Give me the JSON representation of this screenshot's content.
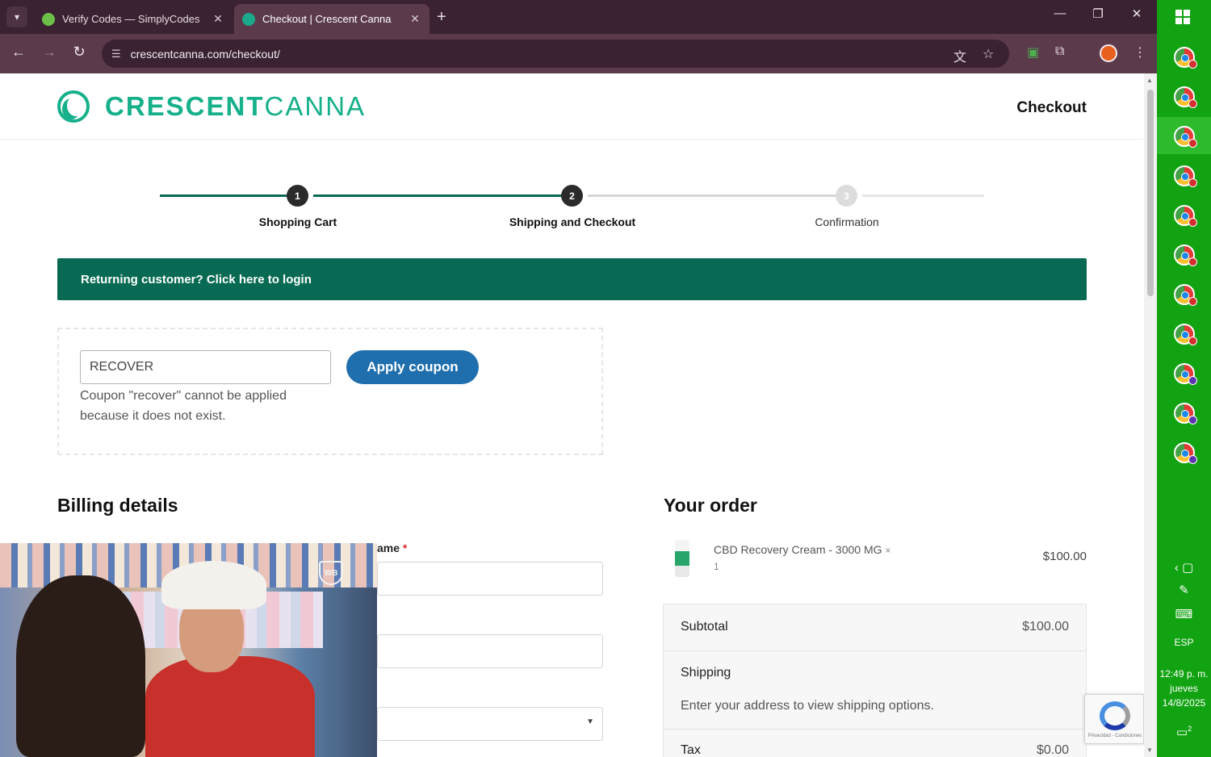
{
  "browser": {
    "tabs": [
      {
        "title": "Verify Codes — SimplyCodes",
        "active": false,
        "favicon_color": "#6cc04a"
      },
      {
        "title": "Checkout | Crescent Canna",
        "active": true,
        "favicon_color": "#1aa98a"
      }
    ],
    "new_tab_icon": "plus-icon",
    "url": "crescentcanna.com/checkout/",
    "colors": {
      "frame": "#3a2232",
      "toolbar": "#5b3a4c"
    }
  },
  "site": {
    "logo_bold": "CRESCENT",
    "logo_light": "CANNA",
    "header_title": "Checkout",
    "brand_color": "#16b08a"
  },
  "steps": [
    {
      "number": "1",
      "label": "Shopping Cart",
      "state": "complete"
    },
    {
      "number": "2",
      "label": "Shipping and Checkout",
      "state": "current"
    },
    {
      "number": "3",
      "label": "Confirmation",
      "state": "pending"
    }
  ],
  "login_banner": "Returning customer? Click here to login",
  "coupon": {
    "value": "RECOVER",
    "button": "Apply coupon",
    "error": "Coupon \"recover\" cannot be applied because it does not exist."
  },
  "billing": {
    "title": "Billing details",
    "partial_label": "ame",
    "required_mark": "*"
  },
  "order": {
    "title": "Your order",
    "item": {
      "name": "CBD Recovery Cream - 3000 MG",
      "qty": "× 1",
      "price": "$100.00"
    },
    "subtotal_label": "Subtotal",
    "subtotal_value": "$100.00",
    "shipping_label": "Shipping",
    "shipping_message": "Enter your address to view shipping options.",
    "tax_label": "Tax",
    "tax_value": "$0.00"
  },
  "recaptcha_text": "Privacidad - Condiciones",
  "video_overlay": {
    "logo": "WB"
  },
  "taskbar": {
    "language": "ESP",
    "time": "12:49 p. m.",
    "day": "jueves",
    "date": "14/8/2025",
    "notification_count": "2"
  }
}
